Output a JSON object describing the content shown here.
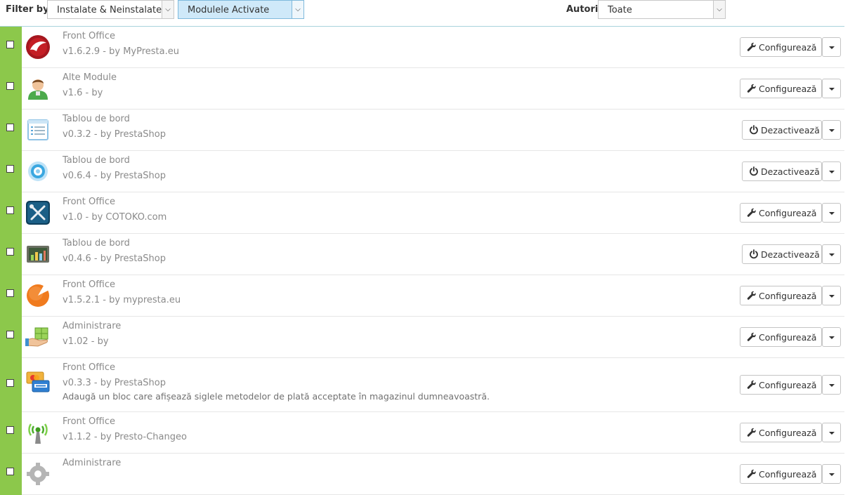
{
  "filter": {
    "label": "Filter by",
    "install_select": "Instalate & Neinstalate",
    "status_select": "Modulele Activate",
    "authors_label": "Autori",
    "authors_select": "Toate"
  },
  "colors": {
    "active_stripe": "#8cc84b",
    "selected_filter_bg": "#cfe9f9"
  },
  "modules": [
    {
      "category": "Front Office",
      "version": "v1.6.2.9 - by MyPresta.eu",
      "action": "Configurează",
      "action_icon": "wrench-icon",
      "icon": "red-swoosh-logo-icon"
    },
    {
      "category": "Alte Module",
      "version": "v1.6 - by",
      "action": "Configurează",
      "action_icon": "wrench-icon",
      "icon": "user-avatar-icon"
    },
    {
      "category": "Tablou de bord",
      "version": "v0.3.2 - by PrestaShop",
      "action": "Dezactivează",
      "action_icon": "power-icon",
      "icon": "list-document-icon"
    },
    {
      "category": "Tablou de bord",
      "version": "v0.6.4 - by PrestaShop",
      "action": "Dezactivează",
      "action_icon": "power-icon",
      "icon": "target-ring-icon"
    },
    {
      "category": "Front Office",
      "version": "v1.0 - by COTOKO.com",
      "action": "Configurează",
      "action_icon": "wrench-icon",
      "icon": "tools-icon"
    },
    {
      "category": "Tablou de bord",
      "version": "v0.4.6 - by PrestaShop",
      "action": "Dezactivează",
      "action_icon": "power-icon",
      "icon": "chart-screen-icon"
    },
    {
      "category": "Front Office",
      "version": "v1.5.2.1 - by mypresta.eu",
      "action": "Configurează",
      "action_icon": "wrench-icon",
      "icon": "orange-pie-icon"
    },
    {
      "category": "Administrare",
      "version": "v1.02 - by",
      "action": "Configurează",
      "action_icon": "wrench-icon",
      "icon": "hand-box-icon"
    },
    {
      "category": "Front Office",
      "version": "v0.3.3 - by PrestaShop",
      "description": "Adaugă un bloc care afișează siglele metodelor de plată acceptate în magazinul dumneavoastră.",
      "action": "Configurează",
      "action_icon": "wrench-icon",
      "icon": "payment-cards-icon"
    },
    {
      "category": "Front Office",
      "version": "v1.1.2 - by Presto-Changeo",
      "action": "Configurează",
      "action_icon": "wrench-icon",
      "icon": "antenna-icon"
    },
    {
      "category": "Administrare",
      "version": "",
      "action": "Configurează",
      "action_icon": "wrench-icon",
      "icon": "gear-icon"
    }
  ]
}
